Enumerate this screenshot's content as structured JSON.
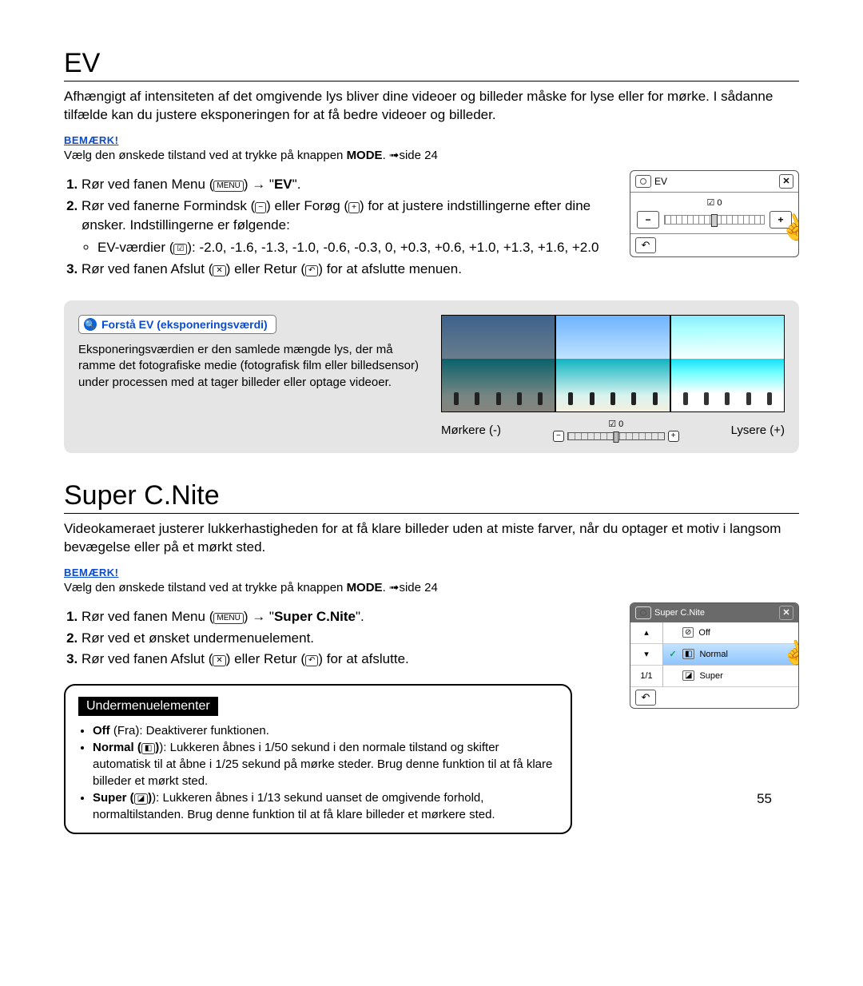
{
  "page_number": "55",
  "ev": {
    "heading": "EV",
    "intro": "Afhængigt af intensiteten af det omgivende lys bliver dine videoer og billeder måske for lyse eller for mørke. I sådanne tilfælde kan du justere eksponeringen for at få bedre videoer og billeder.",
    "bemark_label": "BEMÆRK!",
    "bemark_text_1": "Vælg den ønskede tilstand ved at trykke på knappen ",
    "bemark_mode": "MODE",
    "bemark_text_2": ". ➟side 24",
    "step1_a": "Rør ved fanen Menu (",
    "menu_badge": "MENU",
    "step1_b": ") → \"",
    "step1_bold": "EV",
    "step1_c": "\".",
    "step2_a": "Rør ved fanerne Formindsk (",
    "step2_b": ") eller Forøg (",
    "step2_c": ") for at justere indstillingerne efter dine ønsker. Indstillingerne er følgende:",
    "step2_values_label": "EV-værdier (",
    "step2_values": "): -2.0, -1.6, -1.3, -1.0, -0.6, -0.3, 0, +0.3, +0.6, +1.0, +1.3, +1.6, +2.0",
    "step3_a": "Rør ved fanen Afslut (",
    "step3_b": ") eller Retur (",
    "step3_c": ") for at afslutte menuen.",
    "screen": {
      "title": "EV",
      "value": "☑ 0",
      "minus": "−",
      "plus": "+",
      "back": "↶"
    },
    "info_title": "Forstå EV (eksponeringsværdi)",
    "info_text": "Eksponeringsværdien er den samlede mængde lys, der må ramme det fotografiske medie (fotografisk film eller billedsensor) under processen med at tager billeder eller optage videoer.",
    "darker": "Mørkere (-)",
    "lighter": "Lysere (+)",
    "mid_value": "☑ 0"
  },
  "cnite": {
    "heading": "Super C.Nite",
    "intro": "Videokameraet justerer lukkerhastigheden for at få klare billeder uden at miste farver, når du optager et motiv i langsom bevægelse eller på et mørkt sted.",
    "bemark_label": "BEMÆRK!",
    "bemark_text_1": "Vælg den ønskede tilstand ved at trykke på knappen ",
    "bemark_mode": "MODE",
    "bemark_text_2": ". ➟side 24",
    "step1_a": "Rør ved fanen Menu (",
    "step1_b": ") → \"",
    "step1_bold": "Super C.Nite",
    "step1_c": "\".",
    "step2": "Rør ved et ønsket undermenuelement.",
    "step3_a": "Rør ved fanen Afslut (",
    "step3_b": ") eller Retur (",
    "step3_c": ") for at afslutte.",
    "screen": {
      "title": "Super C.Nite",
      "nav_up": "▴",
      "nav_down": "▾",
      "page": "1/1",
      "back": "↶",
      "items": [
        {
          "check": "",
          "icon": "⊘",
          "label": "Off"
        },
        {
          "check": "✓",
          "icon": "◧",
          "label": "Normal"
        },
        {
          "check": "",
          "icon": "◪",
          "label": "Super"
        }
      ]
    },
    "under_heading": "Undermenuelementer",
    "under": {
      "off_b": "Off",
      "off_rest": " (Fra): Deaktiverer funktionen.",
      "normal_b": "Normal (",
      "normal_rest": "): Lukkeren åbnes i 1/50 sekund i den normale tilstand og skifter automatisk til at åbne i 1/25 sekund på mørke steder. Brug denne funktion til at få klare billeder et mørkt sted.",
      "super_b": "Super (",
      "super_rest": "): Lukkeren åbnes i 1/13 sekund uanset de omgivende forhold, normaltilstanden. Brug denne funktion til at få klare billeder et mørkere sted."
    }
  }
}
